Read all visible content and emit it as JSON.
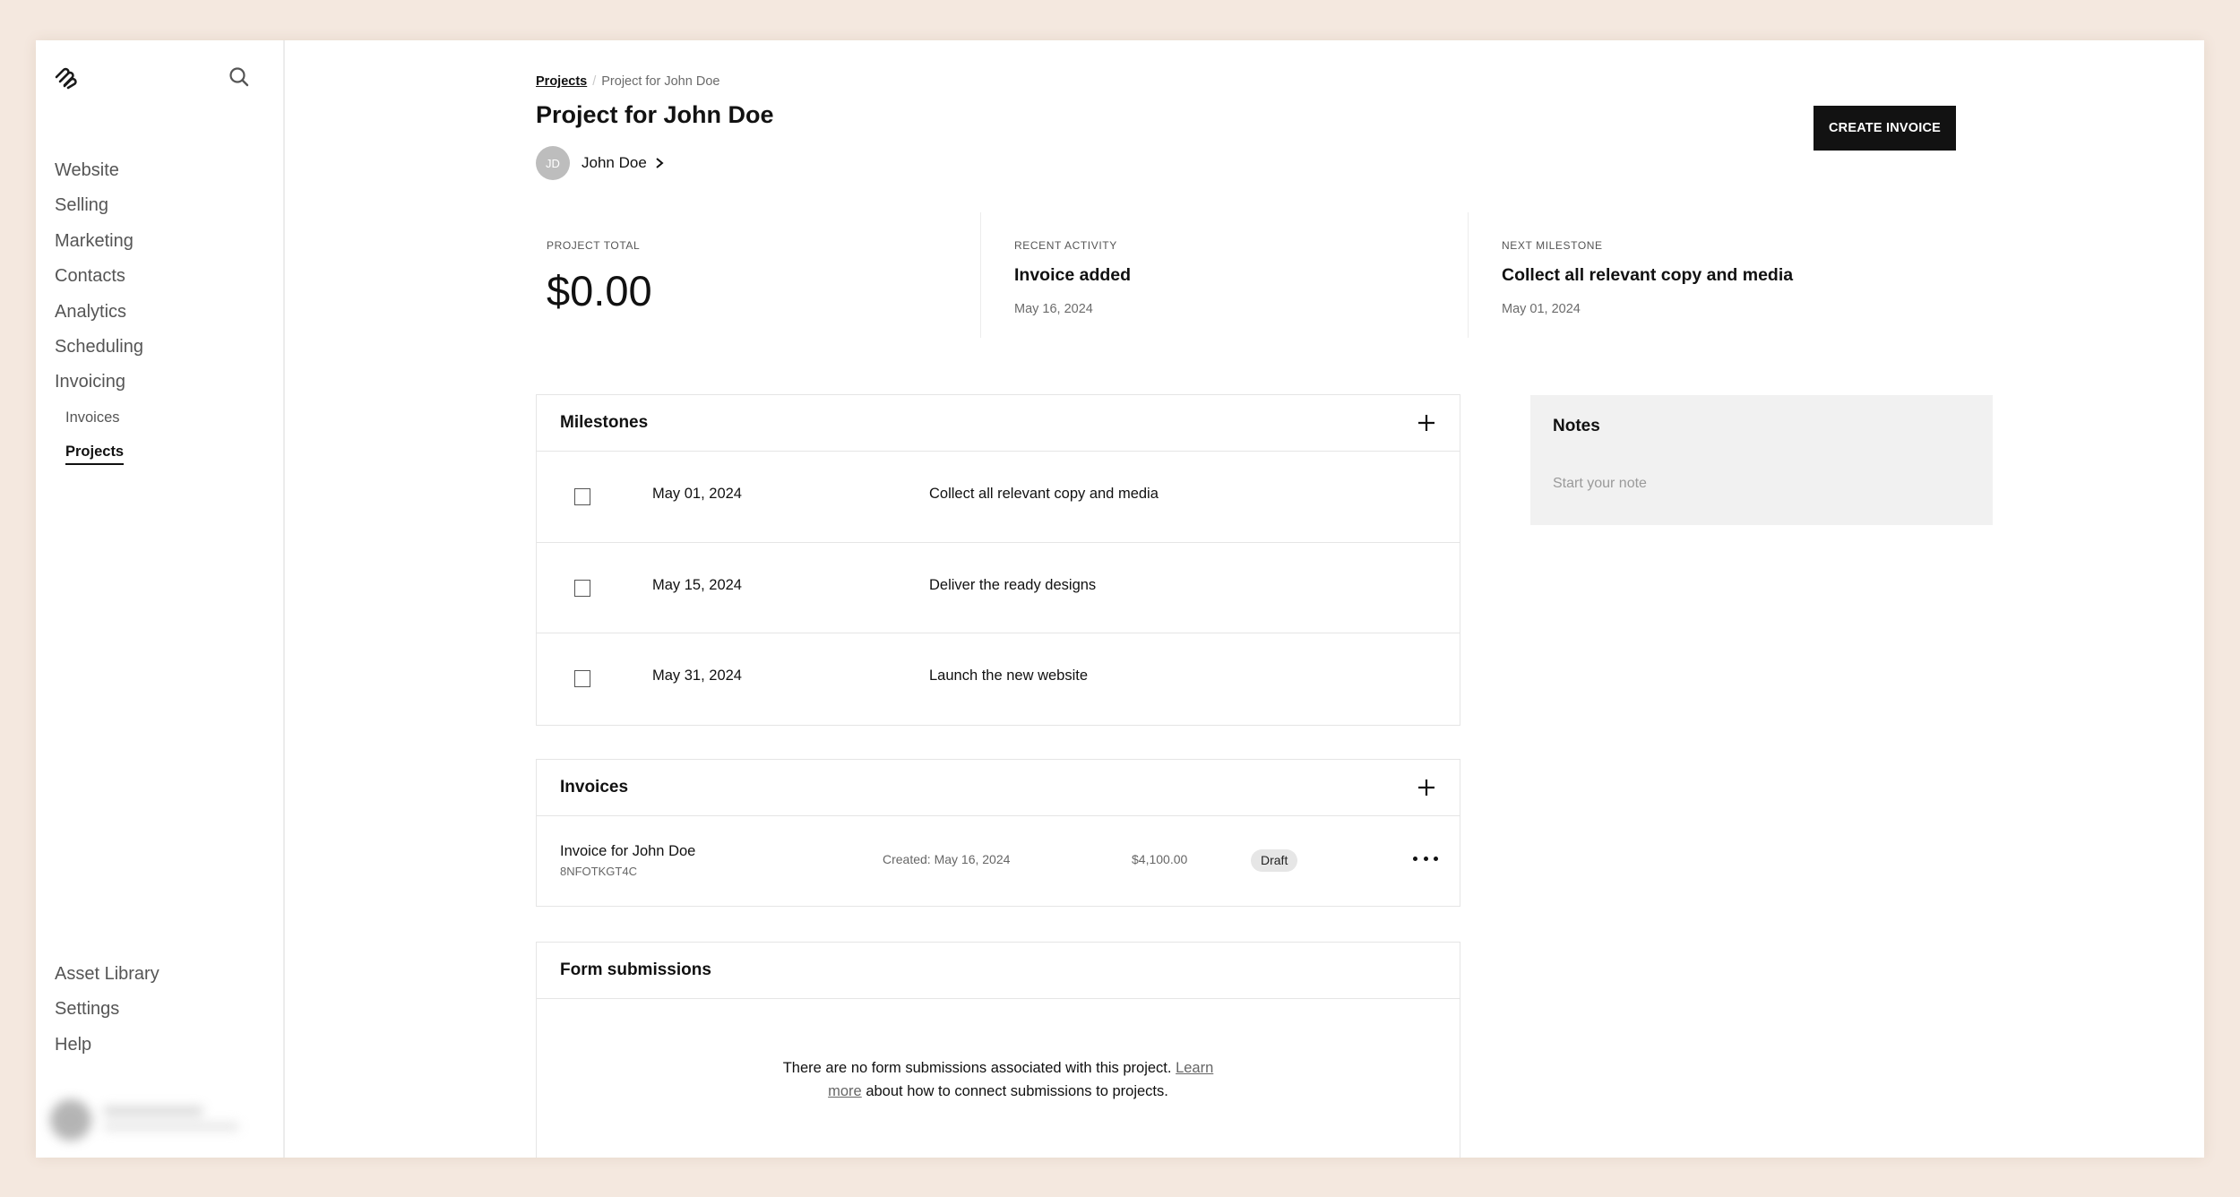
{
  "sidebar": {
    "logo": "squarespace-logo-icon",
    "search_icon": "search-icon",
    "items": [
      {
        "label": "Website"
      },
      {
        "label": "Selling"
      },
      {
        "label": "Marketing"
      },
      {
        "label": "Contacts"
      },
      {
        "label": "Analytics"
      },
      {
        "label": "Scheduling"
      },
      {
        "label": "Invoicing"
      }
    ],
    "subitems": [
      {
        "label": "Invoices",
        "active": false
      },
      {
        "label": "Projects",
        "active": true
      }
    ],
    "bottom_items": [
      {
        "label": "Asset Library"
      },
      {
        "label": "Settings"
      },
      {
        "label": "Help"
      }
    ]
  },
  "header": {
    "breadcrumb": {
      "parent": "Projects",
      "separator": "/",
      "current": "Project for John Doe"
    },
    "title": "Project for John Doe",
    "client": {
      "initials": "JD",
      "name": "John Doe"
    },
    "create_invoice_label": "CREATE INVOICE"
  },
  "stats": {
    "project_total": {
      "label": "PROJECT TOTAL",
      "value": "$0.00"
    },
    "recent_activity": {
      "label": "RECENT ACTIVITY",
      "title": "Invoice added",
      "date": "May 16, 2024"
    },
    "next_milestone": {
      "label": "NEXT MILESTONE",
      "title": "Collect all relevant copy and media",
      "date": "May 01, 2024"
    }
  },
  "milestones": {
    "title": "Milestones",
    "items": [
      {
        "date": "May 01, 2024",
        "text": "Collect all relevant copy and media",
        "done": false
      },
      {
        "date": "May 15, 2024",
        "text": "Deliver the ready designs",
        "done": false
      },
      {
        "date": "May 31, 2024",
        "text": "Launch the new website",
        "done": false
      }
    ]
  },
  "invoices": {
    "title": "Invoices",
    "items": [
      {
        "name": "Invoice for John Doe",
        "id": "8NFOTKGT4C",
        "created": "Created: May 16, 2024",
        "amount": "$4,100.00",
        "status": "Draft"
      }
    ]
  },
  "form_submissions": {
    "title": "Form submissions",
    "empty_text_1": "There are no form submissions associated with this project.",
    "link_part_1": "Learn",
    "link_part_2": "more",
    "empty_text_2": "about how to connect submissions to projects."
  },
  "notes": {
    "title": "Notes",
    "placeholder": "Start your note"
  }
}
